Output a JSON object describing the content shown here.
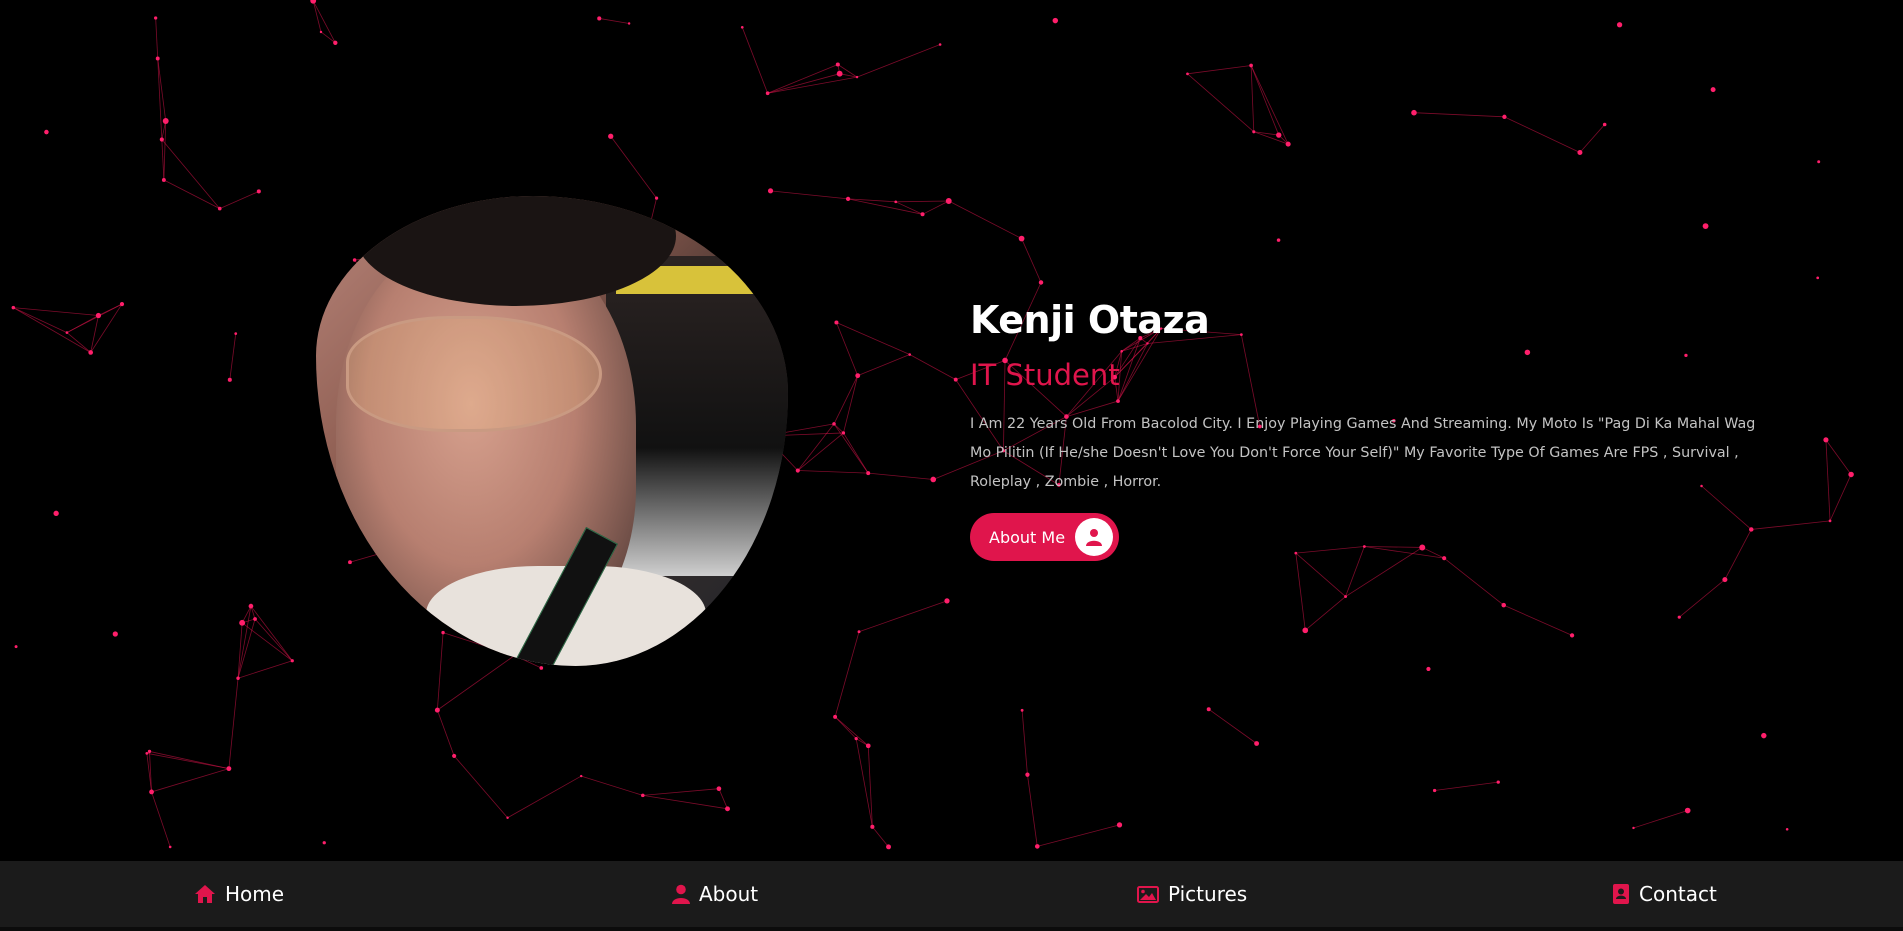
{
  "profile": {
    "name": "Kenji Otaza",
    "role": "IT Student",
    "bio": "I Am 22 Years Old From Bacolod City. I Enjoy Playing Games And Streaming. My Moto Is \"Pag Di Ka Mahal Wag Mo Pilitin (If He/she Doesn't Love You Don't Force Your Self)\" My Favorite Type Of Games Are FPS , Survival , Roleplay , Zombie , Horror.",
    "button_label": "About Me",
    "button_icon": "user-icon"
  },
  "nav": {
    "items": [
      {
        "label": "Home",
        "icon": "home-icon"
      },
      {
        "label": "About",
        "icon": "user-icon"
      },
      {
        "label": "Pictures",
        "icon": "image-icon"
      },
      {
        "label": "Contact",
        "icon": "contact-book-icon"
      }
    ]
  },
  "theme": {
    "accent": "#e0154c",
    "background": "#000000",
    "nav_background": "#1b1b1b",
    "text_primary": "#ffffff",
    "text_secondary": "#c3c3c3"
  }
}
